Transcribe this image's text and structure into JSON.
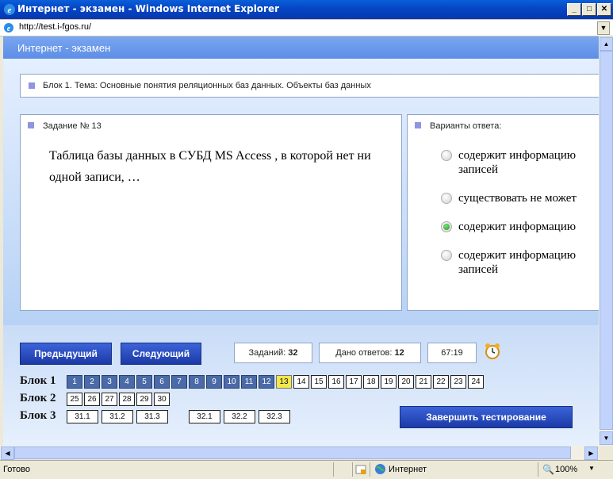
{
  "window": {
    "title": "Интернет - экзамен - Windows Internet Explorer"
  },
  "address": {
    "url": "http://test.i-fgos.ru/"
  },
  "page": {
    "header": "Интернет - экзамен",
    "block_title": "Блок 1. Тема: Основные понятия реляционных баз данных. Объекты баз данных",
    "task_label": "Задание № 13",
    "question": "Таблица базы данных в СУБД MS Access , в которой нет ни одной записи, …",
    "answers_label": "Варианты ответа:",
    "options": [
      {
        "line1": "содержит информацию",
        "line2": "записей",
        "checked": false
      },
      {
        "line1": "существовать не может",
        "line2": "",
        "checked": false
      },
      {
        "line1": "содержит информацию",
        "line2": "",
        "checked": true
      },
      {
        "line1": "содержит информацию",
        "line2": "записей",
        "checked": false
      }
    ]
  },
  "footer": {
    "prev_label": "Предыдущий",
    "next_label": "Следующий",
    "tasks_label": "Заданий:",
    "tasks_count": "32",
    "answers_label": "Дано ответов:",
    "answers_count": "12",
    "timer": "67:19",
    "finish_label": "Завершить тестирование",
    "block1_label": "Блок 1",
    "block2_label": "Блок 2",
    "block3_label": "Блок 3",
    "block1": [
      "1",
      "2",
      "3",
      "4",
      "5",
      "6",
      "7",
      "8",
      "9",
      "10",
      "11",
      "12",
      "13",
      "14",
      "15",
      "16",
      "17",
      "18",
      "19",
      "20",
      "21",
      "22",
      "23",
      "24"
    ],
    "block2": [
      "25",
      "26",
      "27",
      "28",
      "29",
      "30"
    ],
    "block3a": [
      "31.1",
      "31.2",
      "31.3"
    ],
    "block3b": [
      "32.1",
      "32.2",
      "32.3"
    ]
  },
  "status": {
    "text": "Готово",
    "zone": "Интернет",
    "zoom": "100%"
  }
}
